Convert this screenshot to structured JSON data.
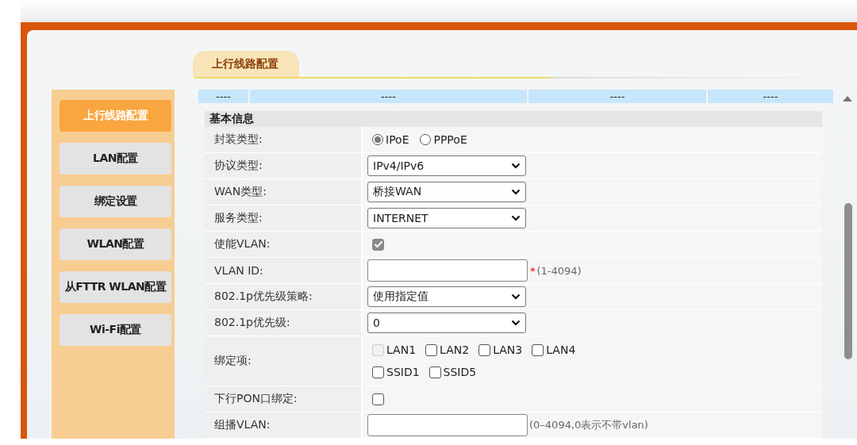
{
  "page_tab": {
    "label": "上行线路配置",
    "selected": true
  },
  "sidebar": {
    "items": [
      {
        "label": "上行线路配置",
        "selected": true
      },
      {
        "label": "LAN配置",
        "selected": false
      },
      {
        "label": "绑定设置",
        "selected": false
      },
      {
        "label": "WLAN配置",
        "selected": false
      },
      {
        "label": "从FTTR WLAN配置",
        "selected": false
      },
      {
        "label": "Wi-Fi配置",
        "selected": false
      }
    ]
  },
  "summary_table": {
    "rows": [
      [
        "----",
        "----",
        "----",
        "----"
      ]
    ]
  },
  "section": {
    "title": "基本信息"
  },
  "form": {
    "rows": [
      {
        "label": "封装类型:",
        "kind": "radio",
        "options": [
          {
            "label": "IPoE",
            "selected": true
          },
          {
            "label": "PPPoE",
            "selected": false
          }
        ]
      },
      {
        "label": "协议类型:",
        "kind": "select",
        "value": "IPv4/IPv6"
      },
      {
        "label": "WAN类型:",
        "kind": "select",
        "value": "桥接WAN"
      },
      {
        "label": "服务类型:",
        "kind": "select",
        "value": "INTERNET"
      },
      {
        "label": "使能VLAN:",
        "kind": "checkbox",
        "checked": true,
        "disabled": true
      },
      {
        "label": "VLAN ID:",
        "kind": "input",
        "mark": "*",
        "hint": "(1-4094)"
      },
      {
        "label": "802.1p优先级策略:",
        "kind": "select",
        "value": "使用指定值"
      },
      {
        "label": "802.1p优先级:",
        "kind": "select",
        "value": "0"
      },
      {
        "label": "绑定项:",
        "kind": "checks",
        "lines": [
          [
            {
              "label": "LAN1",
              "checked": false,
              "disabled": true
            },
            {
              "label": "LAN2",
              "checked": false,
              "disabled": false
            },
            {
              "label": "LAN3",
              "checked": false,
              "disabled": false
            },
            {
              "label": "LAN4",
              "checked": false,
              "disabled": false
            }
          ],
          [
            {
              "label": "SSID1",
              "checked": false,
              "disabled": false
            },
            {
              "label": "SSID5",
              "checked": false,
              "disabled": false
            }
          ]
        ]
      },
      {
        "label": "下行PON口绑定:",
        "kind": "checkbox",
        "checked": false,
        "disabled": false
      },
      {
        "label": "组播VLAN:",
        "kind": "input",
        "hint": "(0–4094,0表示不带vlan)"
      }
    ]
  }
}
